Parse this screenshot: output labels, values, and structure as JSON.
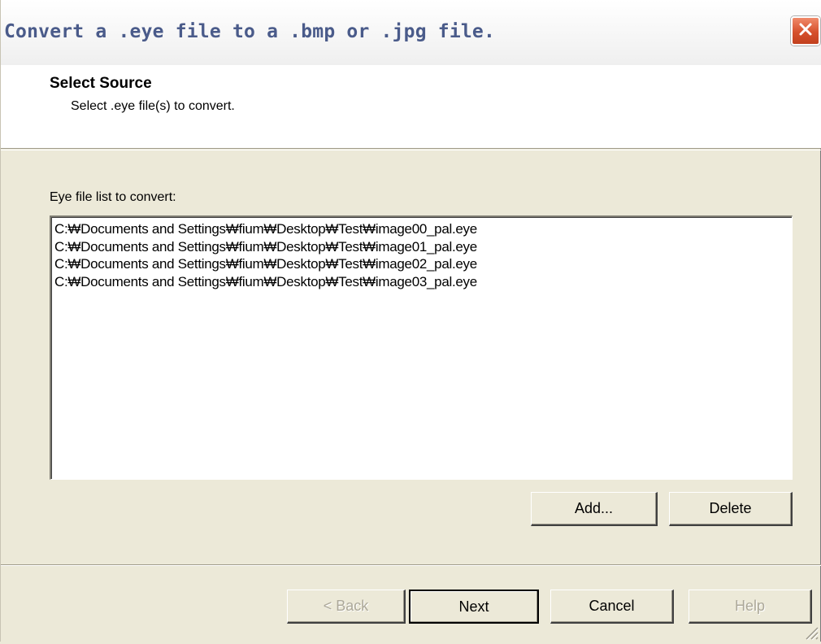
{
  "window": {
    "title": "Convert a .eye file to a .bmp or .jpg file."
  },
  "header": {
    "title": "Select Source",
    "subtitle": "Select .eye file(s) to convert."
  },
  "list": {
    "label": "Eye file list to convert:",
    "items": [
      "C:₩Documents and Settings₩fium₩Desktop₩Test₩image00_pal.eye",
      "C:₩Documents and Settings₩fium₩Desktop₩Test₩image01_pal.eye",
      "C:₩Documents and Settings₩fium₩Desktop₩Test₩image02_pal.eye",
      "C:₩Documents and Settings₩fium₩Desktop₩Test₩image03_pal.eye"
    ]
  },
  "list_buttons": {
    "add": "Add...",
    "delete": "Delete"
  },
  "footer": {
    "back": "< Back",
    "next": "Next",
    "cancel": "Cancel",
    "help": "Help"
  },
  "icons": {
    "close": "close-icon",
    "resize": "resize-grip-icon"
  }
}
